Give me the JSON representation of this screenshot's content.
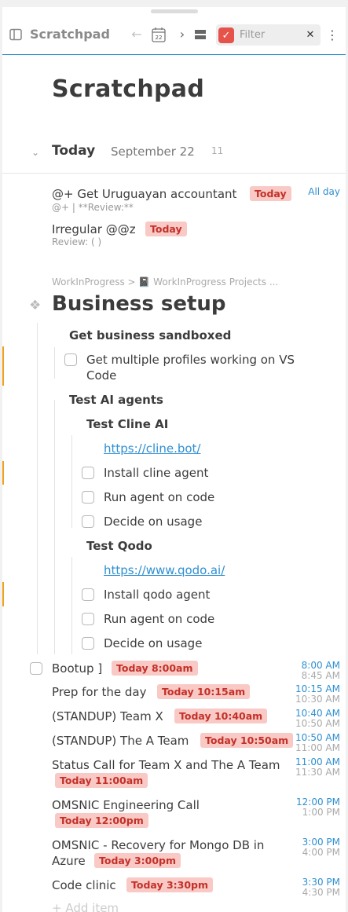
{
  "toolbar": {
    "title": "Scratchpad",
    "calendar_day": "22",
    "filter_placeholder": "Filter",
    "clear_symbol": "✕",
    "more_symbol": "⋮",
    "back_symbol": "←",
    "forward_symbol": "›"
  },
  "page": {
    "title": "Scratchpad"
  },
  "day": {
    "label": "Today",
    "date": "September 22",
    "count": "11"
  },
  "today_tasks": [
    {
      "text": "@+ Get Uruguayan accountant",
      "tag": "Today",
      "sub": "@+ | **Review:**",
      "time": "All day"
    },
    {
      "text": "Irregular @@z",
      "tag": "Today",
      "sub": "Review: ( )"
    }
  ],
  "project": {
    "breadcrumb": "WorkInProgress > 📓 WorkInProgress Projects ...",
    "title": "Business setup",
    "sections": {
      "sandbox_heading": "Get business sandboxed",
      "sandbox_task_line1": "Get multiple profiles working on VS",
      "sandbox_task_line2": "Code",
      "ai_heading": "Test AI agents",
      "cline_heading": "Test Cline AI",
      "cline_link": "https://cline.bot/",
      "cline_tasks": [
        "Install cline agent",
        "Run agent on code",
        "Decide on usage"
      ],
      "qodo_heading": "Test Qodo",
      "qodo_link": "https://www.qodo.ai/",
      "qodo_tasks": [
        "Install qodo agent",
        "Run agent on code",
        "Decide on usage"
      ]
    }
  },
  "events": [
    {
      "text": "Bootup ]",
      "tag": "Today 8:00am",
      "start": "8:00 AM",
      "end": "8:45 AM"
    },
    {
      "text": "Prep for the day",
      "tag": "Today 10:15am",
      "start": "10:15 AM",
      "end": "10:30 AM"
    },
    {
      "text": "(STANDUP) Team X",
      "tag": "Today 10:40am",
      "start": "10:40 AM",
      "end": "10:50 AM"
    },
    {
      "text": "(STANDUP) The A Team",
      "tag": "Today 10:50am",
      "start": "10:50 AM",
      "end": "11:00 AM"
    },
    {
      "text": "Status Call for Team X and The A Team",
      "tag": "Today 11:00am",
      "start": "11:00 AM",
      "end": "11:30 AM"
    },
    {
      "text": "OMSNIC Engineering Call",
      "tag": "Today 12:00pm",
      "start": "12:00 PM",
      "end": "1:00 PM"
    },
    {
      "text_line1": "OMSNIC - Recovery for Mongo DB in",
      "text_line2": "Azure",
      "tag": "Today 3:00pm",
      "start": "3:00 PM",
      "end": "4:00 PM"
    },
    {
      "text": "Code clinic",
      "tag": "Today 3:30pm",
      "start": "3:30 PM",
      "end": "4:30 PM"
    }
  ],
  "add_item": "+ Add item",
  "colors": {
    "accent": "#1f8ad1",
    "tag_bg": "#f9c9c5",
    "tag_text": "#c33028",
    "marker": "#f0a21c",
    "time_blue": "#2e8fd2"
  }
}
